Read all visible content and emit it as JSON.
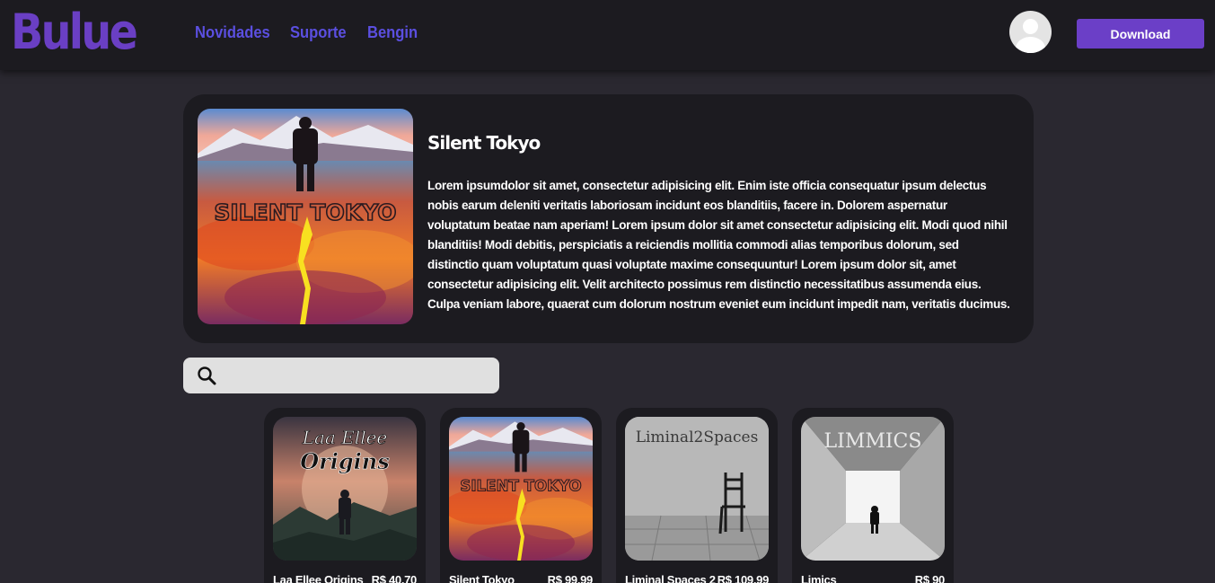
{
  "header": {
    "logo": "Bulue",
    "nav": [
      "Novidades",
      "Suporte",
      "Bengin"
    ],
    "download_label": "Download"
  },
  "featured": {
    "title": "Silent Tokyo",
    "cover_text": "SILENT TOKYO",
    "description": "Lorem ipsumdolor sit amet, consectetur adipisicing elit. Enim iste officia consequatur ipsum delectus nobis earum deleniti veritatis laboriosam incidunt eos blanditiis, facere in. Dolorem aspernatur voluptatum beatae nam aperiam! Lorem ipsum dolor sit amet consectetur adipisicing elit. Modi quod nihil blanditiis! Modi debitis, perspiciatis a reiciendis mollitia commodi alias temporibus dolorum, sed distinctio quam voluptatum quasi voluptate maxime consequuntur! Lorem ipsum dolor sit, amet consectetur adipisicing elit. Velit architecto possimus rem distinctio necessitatibus assumenda eius. Culpa veniam labore, quaerat cum dolorum nostrum eveniet eum incidunt impedit nam, veritatis ducimus."
  },
  "search": {
    "placeholder": "",
    "icon": "search-icon"
  },
  "products": [
    {
      "name": "Laa Ellee Origins",
      "price": "R$ 40,70",
      "cover_line1": "Laa Ellee",
      "cover_line2": "Origins"
    },
    {
      "name": "Silent Tokyo",
      "price": "R$ 99,99",
      "cover_line1": "SILENT TOKYO",
      "cover_line2": ""
    },
    {
      "name": "Liminal Spaces 2",
      "price": "R$ 109,99",
      "cover_line1": "Liminal2Spaces",
      "cover_line2": ""
    },
    {
      "name": "Limics",
      "price": "R$ 90",
      "cover_line1": "LIMMICS",
      "cover_line2": ""
    }
  ],
  "colors": {
    "background": "#2a2830",
    "panel": "#1c1b20",
    "accent": "#6b3fc7",
    "nav_link": "#5b4fe0"
  }
}
